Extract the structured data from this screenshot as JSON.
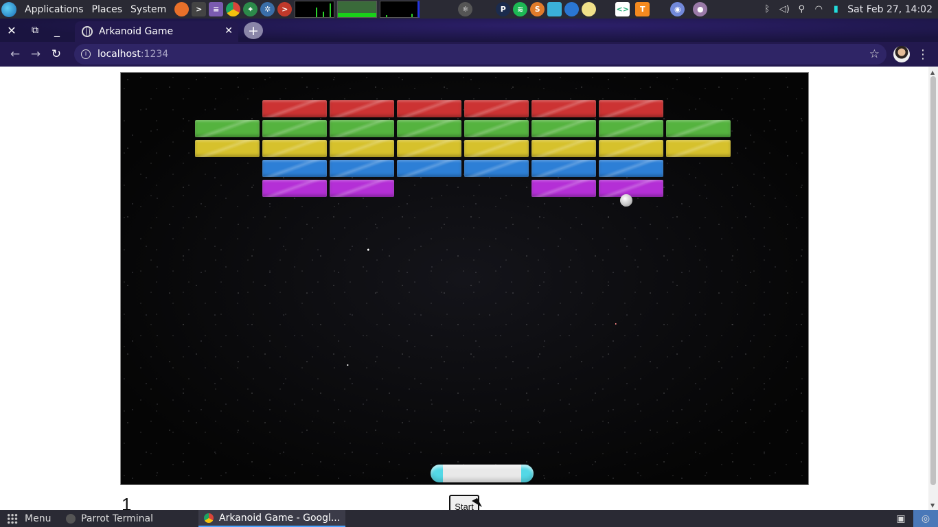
{
  "system_panel": {
    "menus": [
      "Applications",
      "Places",
      "System"
    ],
    "clock": "Sat Feb 27, 14:02",
    "launchers": [
      {
        "icon": "firefox-icon",
        "color": "#e8702a"
      },
      {
        "icon": "terminal-icon",
        "color": "#444444"
      },
      {
        "icon": "text-editor-icon",
        "color": "#7b5bb0"
      },
      {
        "icon": "chrome-icon",
        "color": "#d9453a"
      },
      {
        "icon": "map-icon",
        "color": "#2c8a4a"
      },
      {
        "icon": "network-icon",
        "color": "#3a6ea8"
      },
      {
        "icon": "root-terminal-icon",
        "color": "#c0392b"
      }
    ]
  },
  "browser": {
    "tab_title": "Arkanoid Game",
    "url_host": "localhost",
    "url_port": ":1234"
  },
  "game": {
    "score": "1",
    "start_label": "Start",
    "brick_colors": {
      "red": "#cc3333",
      "green": "#55b33f",
      "yellow": "#d6c12c",
      "blue": "#2d7fd6",
      "purple": "#b42fd6"
    },
    "rows": [
      {
        "color": "red",
        "bricks": [
          0,
          1,
          1,
          1,
          1,
          1,
          1,
          0
        ]
      },
      {
        "color": "green",
        "bricks": [
          1,
          1,
          1,
          1,
          1,
          1,
          1,
          1
        ]
      },
      {
        "color": "yellow",
        "bricks": [
          1,
          1,
          1,
          1,
          1,
          1,
          1,
          1
        ]
      },
      {
        "color": "blue",
        "bricks": [
          0,
          1,
          1,
          1,
          1,
          1,
          1,
          0
        ]
      },
      {
        "color": "purple",
        "bricks": [
          0,
          1,
          1,
          0,
          0,
          1,
          1,
          0
        ]
      }
    ]
  },
  "taskbar": {
    "menu_label": "Menu",
    "tasks": [
      {
        "label": "Parrot Terminal",
        "active": false
      },
      {
        "label": "Arkanoid Game - Googl...",
        "active": true
      }
    ]
  }
}
